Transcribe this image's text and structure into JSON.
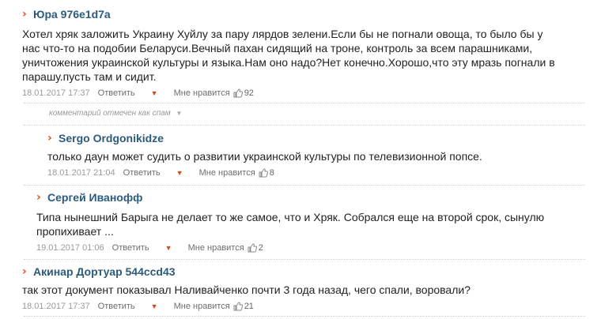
{
  "comments": [
    {
      "author": "Юра 976e1d7a",
      "lines": [
        "Хотел хряк заложить Украину Хуйлу за пару лярдов зелени.Если бы не погнали овоща, то было бы у",
        "нас что-то на подобии Беларуси.Вечный пахан сидящий на троне, контроль за всем парашниками,",
        "уничтожения украинской культуры и языка.Нам оно надо?Нет конечно.Хорошо,что эту мразь погнали в",
        "парашу.пусть там и сидит."
      ],
      "date": "18.01.2017 17:37",
      "reply": "Ответить",
      "like": "Мне нравится",
      "count": "92"
    },
    {
      "author": "Sergo Ordgonikidze",
      "lines": [
        "только даун может судить о развитии украинской культуры по телевизионной попсе."
      ],
      "date": "18.01.2017 21:04",
      "reply": "Ответить",
      "like": "Мне нравится",
      "count": "8"
    },
    {
      "author": "Сергей Иванофф",
      "lines": [
        "Типа нынешний Барыга не делает то же самое, что и Хряк. Собрался еще на второй срок, сынулю",
        "пропихивает ..."
      ],
      "date": "19.01.2017 01:06",
      "reply": "Ответить",
      "like": "Мне нравится",
      "count": "2"
    },
    {
      "author": "Акинар Дортуар 544ccd43",
      "lines": [
        "так этот документ показывал Наливайченко почти 3 года назад, чего спали, воровали?"
      ],
      "date": "18.01.2017 17:37",
      "reply": "Ответить",
      "like": "Мне нравится",
      "count": "21"
    }
  ],
  "spam_note": "комментарий отмечен как спам",
  "icons": {
    "author_marker": "chevron-right-icon",
    "dropdown": "caret-down-icon",
    "like": "thumbs-up-icon"
  },
  "colors": {
    "accent": "#e8461b",
    "author": "#2b5b7d"
  }
}
